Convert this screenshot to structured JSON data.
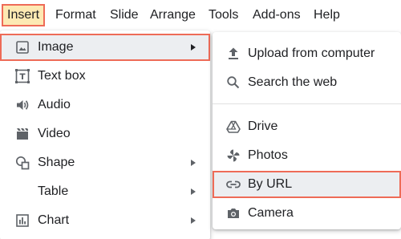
{
  "menubar": {
    "items": [
      "Insert",
      "Format",
      "Slide",
      "Arrange",
      "Tools",
      "Add-ons",
      "Help"
    ]
  },
  "insert_menu": {
    "items": [
      {
        "label": "Image",
        "icon": "image-icon",
        "submenu": true
      },
      {
        "label": "Text box",
        "icon": "text-box-icon",
        "submenu": false
      },
      {
        "label": "Audio",
        "icon": "audio-icon",
        "submenu": false
      },
      {
        "label": "Video",
        "icon": "video-icon",
        "submenu": false
      },
      {
        "label": "Shape",
        "icon": "shape-icon",
        "submenu": true
      },
      {
        "label": "Table",
        "icon": "",
        "submenu": true
      },
      {
        "label": "Chart",
        "icon": "chart-icon",
        "submenu": true
      }
    ]
  },
  "image_submenu": {
    "items": [
      {
        "label": "Upload from computer",
        "icon": "upload-icon"
      },
      {
        "label": "Search the web",
        "icon": "search-icon"
      },
      {
        "label": "Drive",
        "icon": "drive-icon"
      },
      {
        "label": "Photos",
        "icon": "photos-icon"
      },
      {
        "label": "By URL",
        "icon": "link-icon"
      },
      {
        "label": "Camera",
        "icon": "camera-icon"
      }
    ]
  },
  "colors": {
    "highlight_box": "#ee6b57",
    "active_menu_bg": "#fde9b3",
    "hover_bg": "#eceef1",
    "text": "#202124",
    "icon": "#5f6368"
  }
}
